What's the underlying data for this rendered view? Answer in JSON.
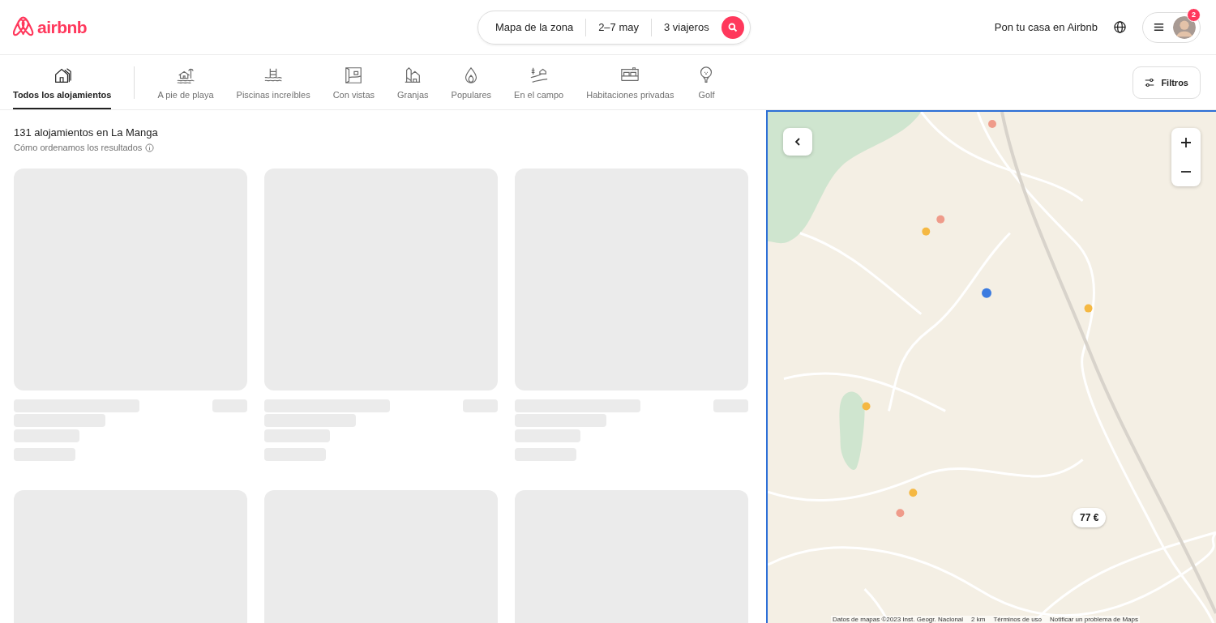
{
  "logo": {
    "text": "airbnb"
  },
  "search": {
    "segments": [
      "Mapa de la zona",
      "2–7 may",
      "3 viajeros"
    ]
  },
  "host_link": "Pon tu casa en Airbnb",
  "user_menu": {
    "badge": "2"
  },
  "categories": [
    {
      "label": "Todos los alojamientos",
      "selected": true
    },
    {
      "label": "A pie de playa",
      "selected": false
    },
    {
      "label": "Piscinas increíbles",
      "selected": false
    },
    {
      "label": "Con vistas",
      "selected": false
    },
    {
      "label": "Granjas",
      "selected": false
    },
    {
      "label": "Populares",
      "selected": false
    },
    {
      "label": "En el campo",
      "selected": false
    },
    {
      "label": "Habitaciones privadas",
      "selected": false
    },
    {
      "label": "Golf",
      "selected": false
    }
  ],
  "filters_button": "Filtros",
  "results": {
    "title": "131 alojamientos en La Manga",
    "subtitle": "Cómo ordenamos los resultados"
  },
  "listings": [
    {
      "loading": true
    },
    {
      "loading": true
    },
    {
      "loading": true
    },
    {
      "loading": true
    },
    {
      "loading": true
    },
    {
      "loading": true
    }
  ],
  "map": {
    "kind": "picture",
    "price_marker": "77 €",
    "attribution": [
      "Datos de mapas ©2023 Inst. Geogr. Nacional",
      "2 km",
      "Términos de uso",
      "Notificar un problema de Maps"
    ]
  }
}
